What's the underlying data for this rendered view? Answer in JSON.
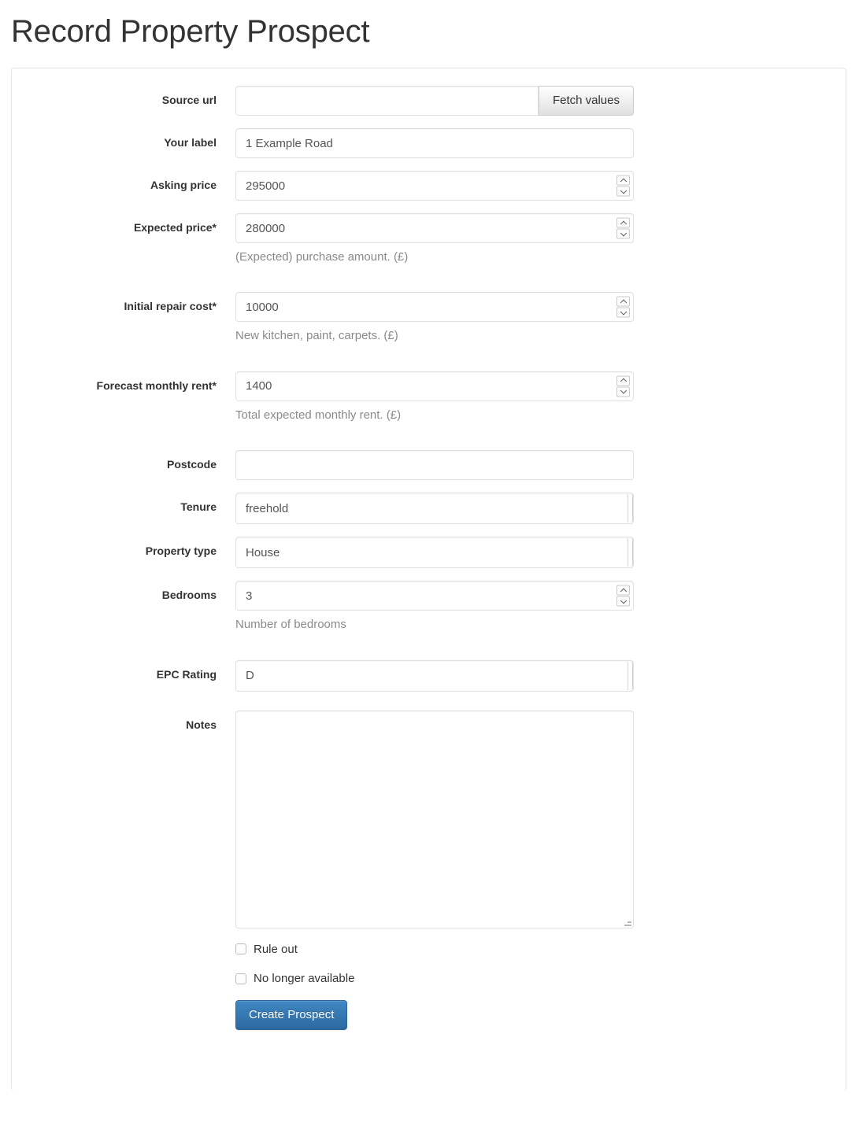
{
  "page": {
    "title": "Record Property Prospect"
  },
  "form": {
    "source_url": {
      "label": "Source url",
      "value": "",
      "button_label": "Fetch values"
    },
    "your_label": {
      "label": "Your label",
      "value": "1 Example Road"
    },
    "asking_price": {
      "label": "Asking price",
      "value": "295000"
    },
    "expected_price": {
      "label": "Expected price*",
      "value": "280000",
      "help": "(Expected) purchase amount. (£)"
    },
    "initial_repair_cost": {
      "label": "Initial repair cost*",
      "value": "10000",
      "help": "New kitchen, paint, carpets. (£)"
    },
    "forecast_monthly_rent": {
      "label": "Forecast monthly rent*",
      "value": "1400",
      "help": "Total expected monthly rent. (£)"
    },
    "postcode": {
      "label": "Postcode",
      "value": ""
    },
    "tenure": {
      "label": "Tenure",
      "value": "freehold"
    },
    "property_type": {
      "label": "Property type",
      "value": "House"
    },
    "bedrooms": {
      "label": "Bedrooms",
      "value": "3",
      "help": "Number of bedrooms"
    },
    "epc_rating": {
      "label": "EPC Rating",
      "value": "D"
    },
    "notes": {
      "label": "Notes",
      "value": ""
    },
    "rule_out": {
      "label": "Rule out",
      "checked": false
    },
    "no_longer_available": {
      "label": "No longer available",
      "checked": false
    },
    "submit": {
      "label": "Create Prospect"
    }
  },
  "colors": {
    "primary_button": "#3276b1",
    "primary_button_border": "#2b669a",
    "title_text": "#333333",
    "help_text": "#8a8a8a",
    "input_text": "#555555",
    "input_border": "#e0e0e0"
  },
  "icons": {
    "spinner_up": "spinner-up-icon",
    "spinner_down": "spinner-down-icon",
    "resize_grip": "resize-grip-icon"
  }
}
